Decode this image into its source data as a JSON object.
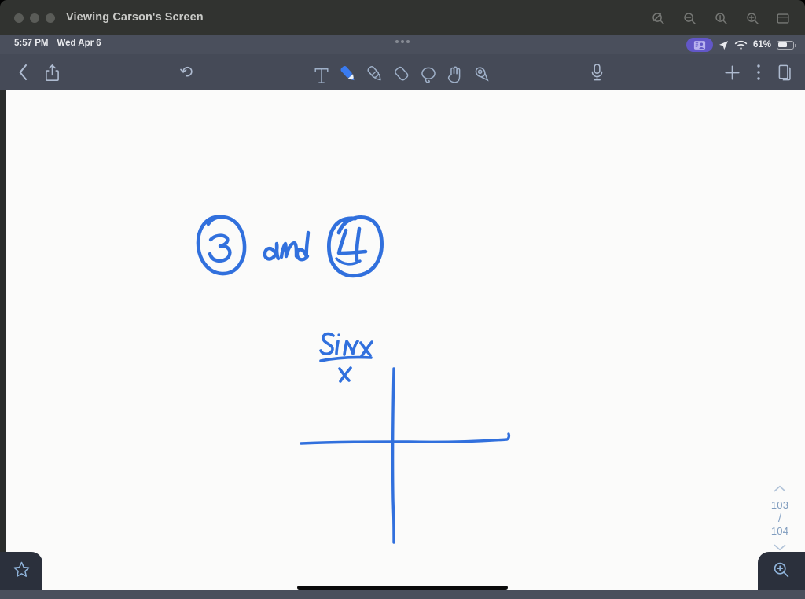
{
  "window": {
    "title": "Viewing Carson's Screen",
    "traffic_lights": [
      "close",
      "minimize",
      "maximize"
    ],
    "toolbar_icons": [
      {
        "name": "zoom-disabled-icon",
        "label": "Zoom Off"
      },
      {
        "name": "zoom-out-icon",
        "label": "Zoom Out"
      },
      {
        "name": "zoom-fit-icon",
        "label": "Actual Size"
      },
      {
        "name": "zoom-in-icon",
        "label": "Zoom In"
      },
      {
        "name": "window-list-icon",
        "label": "Window List"
      }
    ]
  },
  "statusbar": {
    "time": "5:57 PM",
    "date": "Wed Apr 6",
    "multitask_handle": "multitasking-handle",
    "screen_share_badge": "screen-sharing-badge",
    "location_icon": "location-arrow-icon",
    "wifi_icon": "wifi-icon",
    "battery_percent": "61%",
    "battery_icon": "battery-icon",
    "badge_color": "#6257c7"
  },
  "app_toolbar": {
    "back_label": "Back",
    "share_label": "Share",
    "undo_label": "Undo",
    "microphone_label": "Record Audio",
    "add_label": "Add",
    "more_label": "More",
    "pages_label": "Pages",
    "tools": [
      {
        "name": "text-tool",
        "label": "Text",
        "active": false
      },
      {
        "name": "pen-tool",
        "label": "Pen",
        "active": true
      },
      {
        "name": "highlighter-tool",
        "label": "Highlighter",
        "active": false
      },
      {
        "name": "eraser-tool",
        "label": "Eraser",
        "active": false
      },
      {
        "name": "lasso-tool",
        "label": "Lasso",
        "active": false
      },
      {
        "name": "hand-tool",
        "label": "Hand",
        "active": false
      },
      {
        "name": "shape-tool",
        "label": "Shape",
        "active": false
      }
    ]
  },
  "canvas": {
    "background_color": "#fbfbfa",
    "ink_color": "#3170dd",
    "handwriting": [
      {
        "name": "circled-three",
        "text": "3",
        "circled": true
      },
      {
        "name": "and-text",
        "text": "and",
        "circled": false
      },
      {
        "name": "circled-four",
        "text": "4",
        "circled": true
      },
      {
        "name": "fraction-numerator",
        "text": "Sinx",
        "circled": false
      },
      {
        "name": "fraction-denominator",
        "text": "x",
        "circled": false
      },
      {
        "name": "coordinate-axes",
        "text": "",
        "circled": false
      }
    ]
  },
  "page_nav": {
    "prev_label": "Previous Page",
    "next_label": "Next Page",
    "current_page": "103",
    "separator": "/",
    "total_pages": "104"
  },
  "bottom": {
    "favorite_label": "Favorite",
    "zoom_in_label": "Zoom In",
    "home_indicator": "home-indicator"
  }
}
